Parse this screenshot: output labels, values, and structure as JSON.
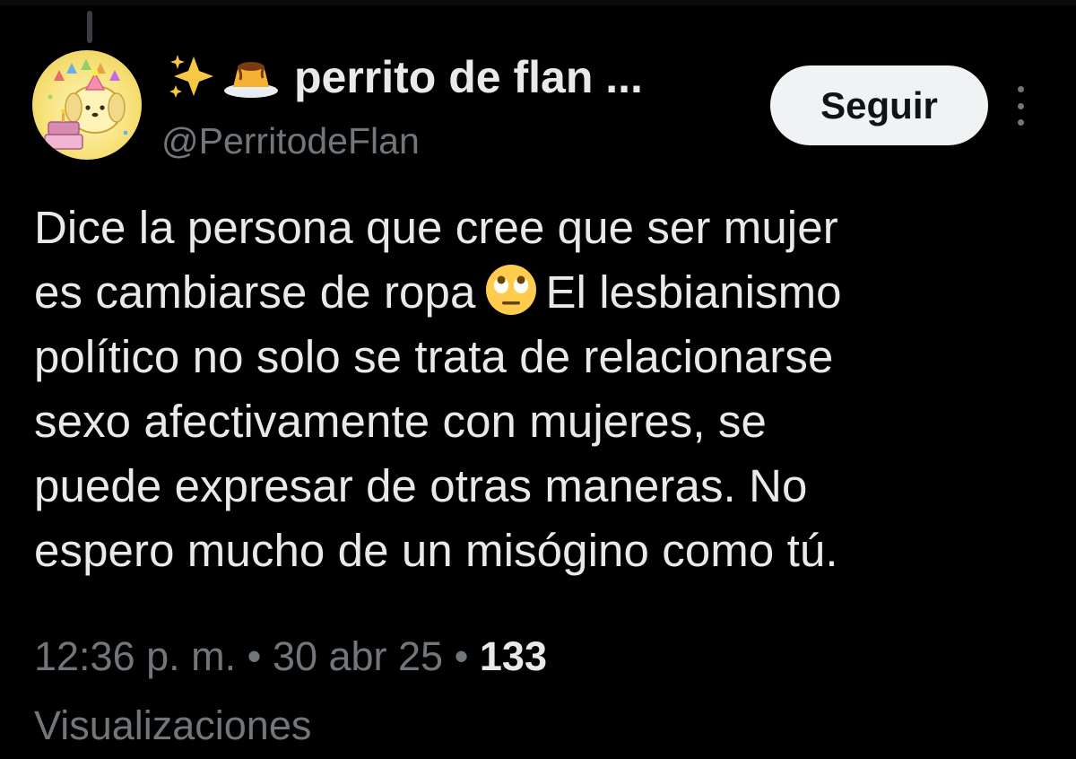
{
  "tweet": {
    "author": {
      "display_name": "perrito de flan ...",
      "name_emojis": [
        "sparkles-icon",
        "custard-icon"
      ],
      "handle": "@PerritodeFlan"
    },
    "follow_label": "Seguir",
    "text_lines": [
      "Dice la persona que cree que ser mujer",
      "es cambiarse de ropa",
      "El lesbianismo",
      "político no solo se trata de relacionarse",
      "sexo afectivamente con mujeres, se",
      "puede expresar de otras maneras. No",
      "espero mucho de un misógino como tú."
    ],
    "inline_emoji": "face-with-rolling-eyes-icon",
    "meta": {
      "time": "12:36 p. m.",
      "separator": "•",
      "date": "30 abr 25",
      "views_count": "133",
      "views_label": "Visualizaciones"
    }
  },
  "colors": {
    "background": "#000000",
    "primary_text": "#e7e9ea",
    "secondary_text": "#71767b",
    "button_bg": "#eff3f4",
    "button_text": "#0f1419"
  }
}
